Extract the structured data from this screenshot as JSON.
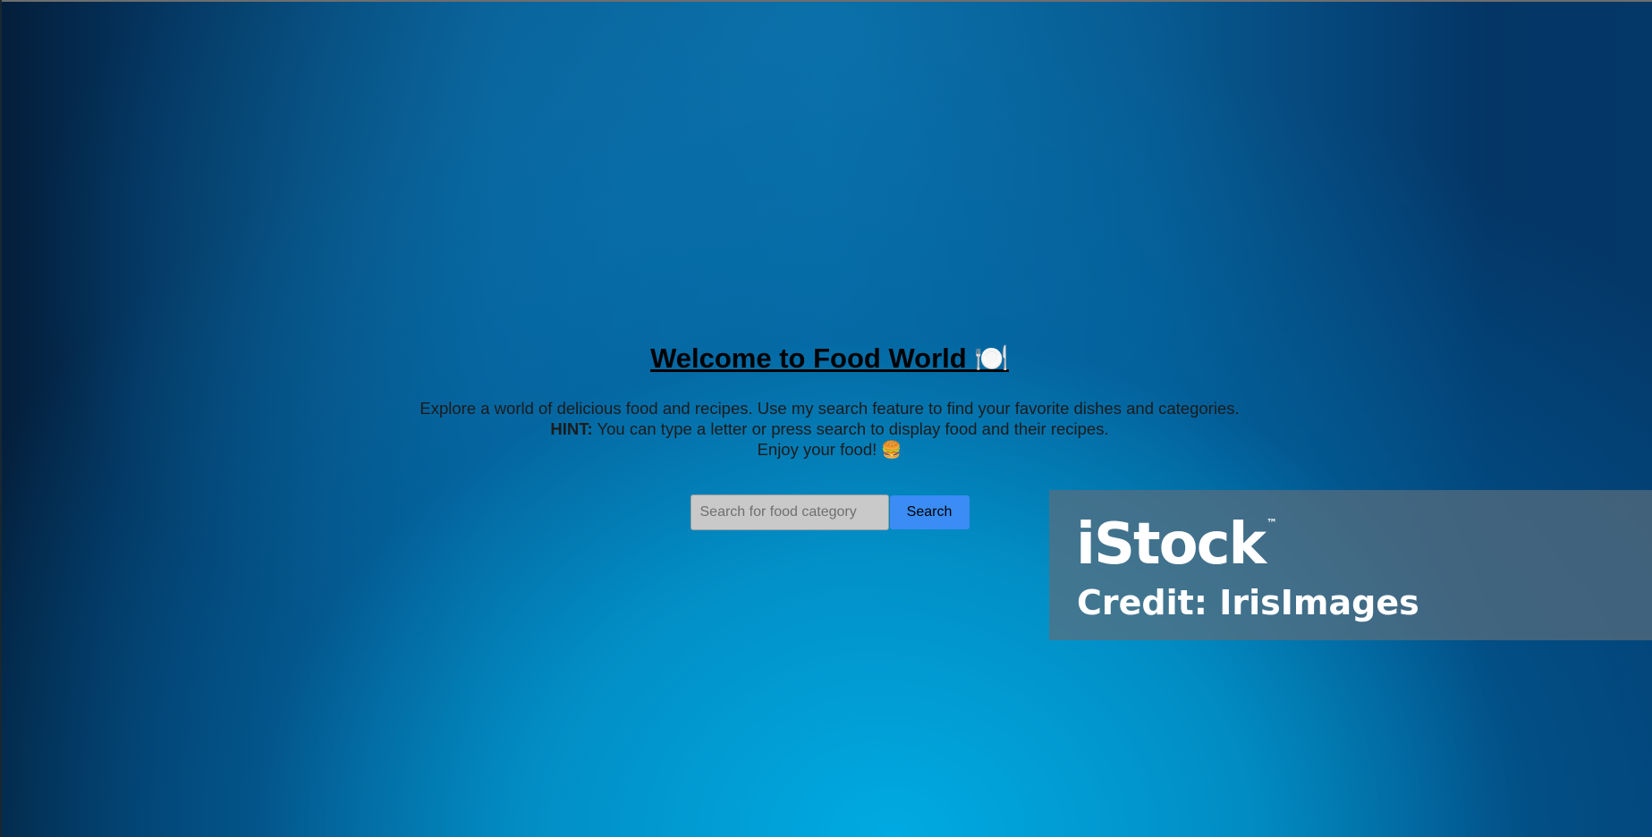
{
  "page": {
    "title": "Welcome to Food World 🍽️",
    "intro": "Explore a world of delicious food and recipes. Use my search feature to find your favorite dishes and categories.",
    "hint_label": "HINT:",
    "hint_text": " You can type a letter or press search to display food and their recipes.",
    "closing": "Enjoy your food! 🍔"
  },
  "search": {
    "placeholder": "Search for food category",
    "value": "",
    "button_label": "Search"
  },
  "watermark": {
    "logo": "iStock",
    "trademark": "™",
    "credit": "Credit: IrisImages"
  },
  "colors": {
    "search_button": "#3b8cf4",
    "background_center": "#00a6dc",
    "background_edge": "#041e3a"
  }
}
